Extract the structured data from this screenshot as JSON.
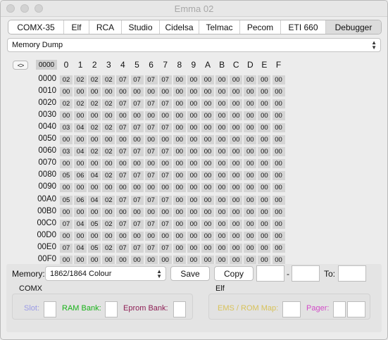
{
  "window": {
    "title": "Emma 02"
  },
  "tabs": [
    "COMX-35",
    "Elf",
    "RCA",
    "Studio",
    "Cidelsa",
    "Telmac",
    "Pecom",
    "ETI 660",
    "Debugger"
  ],
  "active_tab": "Debugger",
  "view_select": {
    "value": "Memory Dump"
  },
  "dump": {
    "nav_label": "<>",
    "start_address": "0000",
    "columns": [
      "0",
      "1",
      "2",
      "3",
      "4",
      "5",
      "6",
      "7",
      "8",
      "9",
      "A",
      "B",
      "C",
      "D",
      "E",
      "F"
    ],
    "rows": [
      {
        "addr": "0000",
        "bytes": [
          "02",
          "02",
          "02",
          "02",
          "07",
          "07",
          "07",
          "07",
          "00",
          "00",
          "00",
          "00",
          "00",
          "00",
          "00",
          "00"
        ]
      },
      {
        "addr": "0010",
        "bytes": [
          "00",
          "00",
          "00",
          "00",
          "00",
          "00",
          "00",
          "00",
          "00",
          "00",
          "00",
          "00",
          "00",
          "00",
          "00",
          "00"
        ]
      },
      {
        "addr": "0020",
        "bytes": [
          "02",
          "02",
          "02",
          "02",
          "07",
          "07",
          "07",
          "07",
          "00",
          "00",
          "00",
          "00",
          "00",
          "00",
          "00",
          "00"
        ]
      },
      {
        "addr": "0030",
        "bytes": [
          "00",
          "00",
          "00",
          "00",
          "00",
          "00",
          "00",
          "00",
          "00",
          "00",
          "00",
          "00",
          "00",
          "00",
          "00",
          "00"
        ]
      },
      {
        "addr": "0040",
        "bytes": [
          "03",
          "04",
          "02",
          "02",
          "07",
          "07",
          "07",
          "07",
          "00",
          "00",
          "00",
          "00",
          "00",
          "00",
          "00",
          "00"
        ]
      },
      {
        "addr": "0050",
        "bytes": [
          "00",
          "00",
          "00",
          "00",
          "00",
          "00",
          "00",
          "00",
          "00",
          "00",
          "00",
          "00",
          "00",
          "00",
          "00",
          "00"
        ]
      },
      {
        "addr": "0060",
        "bytes": [
          "03",
          "04",
          "02",
          "02",
          "07",
          "07",
          "07",
          "07",
          "00",
          "00",
          "00",
          "00",
          "00",
          "00",
          "00",
          "00"
        ]
      },
      {
        "addr": "0070",
        "bytes": [
          "00",
          "00",
          "00",
          "00",
          "00",
          "00",
          "00",
          "00",
          "00",
          "00",
          "00",
          "00",
          "00",
          "00",
          "00",
          "00"
        ]
      },
      {
        "addr": "0080",
        "bytes": [
          "05",
          "06",
          "04",
          "02",
          "07",
          "07",
          "07",
          "07",
          "00",
          "00",
          "00",
          "00",
          "00",
          "00",
          "00",
          "00"
        ]
      },
      {
        "addr": "0090",
        "bytes": [
          "00",
          "00",
          "00",
          "00",
          "00",
          "00",
          "00",
          "00",
          "00",
          "00",
          "00",
          "00",
          "00",
          "00",
          "00",
          "00"
        ]
      },
      {
        "addr": "00A0",
        "bytes": [
          "05",
          "06",
          "04",
          "02",
          "07",
          "07",
          "07",
          "07",
          "00",
          "00",
          "00",
          "00",
          "00",
          "00",
          "00",
          "00"
        ]
      },
      {
        "addr": "00B0",
        "bytes": [
          "00",
          "00",
          "00",
          "00",
          "00",
          "00",
          "00",
          "00",
          "00",
          "00",
          "00",
          "00",
          "00",
          "00",
          "00",
          "00"
        ]
      },
      {
        "addr": "00C0",
        "bytes": [
          "07",
          "04",
          "05",
          "02",
          "07",
          "07",
          "07",
          "07",
          "00",
          "00",
          "00",
          "00",
          "00",
          "00",
          "00",
          "00"
        ]
      },
      {
        "addr": "00D0",
        "bytes": [
          "00",
          "00",
          "00",
          "00",
          "00",
          "00",
          "00",
          "00",
          "00",
          "00",
          "00",
          "00",
          "00",
          "00",
          "00",
          "00"
        ]
      },
      {
        "addr": "00E0",
        "bytes": [
          "07",
          "04",
          "05",
          "02",
          "07",
          "07",
          "07",
          "07",
          "00",
          "00",
          "00",
          "00",
          "00",
          "00",
          "00",
          "00"
        ]
      },
      {
        "addr": "00F0",
        "bytes": [
          "00",
          "00",
          "00",
          "00",
          "00",
          "00",
          "00",
          "00",
          "00",
          "00",
          "00",
          "00",
          "00",
          "00",
          "00",
          "00"
        ]
      }
    ]
  },
  "controls": {
    "memory_label": "Memory:",
    "memory_select": "1862/1864 Colour",
    "save_label": "Save",
    "copy_label": "Copy",
    "dash": "-",
    "to_label": "To:",
    "range_from_value": "",
    "range_to_value": "",
    "dest_value": ""
  },
  "comx": {
    "group_label": "COMX",
    "slot_label": "Slot:",
    "ram_bank_label": "RAM Bank:",
    "eprom_bank_label": "Eprom Bank:",
    "slot_value": "",
    "ram_bank_value": "",
    "eprom_bank_value": ""
  },
  "elf": {
    "group_label": "Elf",
    "ems_label": "EMS / ROM Map:",
    "pager_label": "Pager:",
    "ems_value": "",
    "pager_value_1": "",
    "pager_value_2": ""
  },
  "colors": {
    "slot": "#9a9ae6",
    "ram_bank": "#18b218",
    "eprom_bank": "#8e1f55",
    "ems": "#d8c25a",
    "pager": "#d24bc8"
  }
}
